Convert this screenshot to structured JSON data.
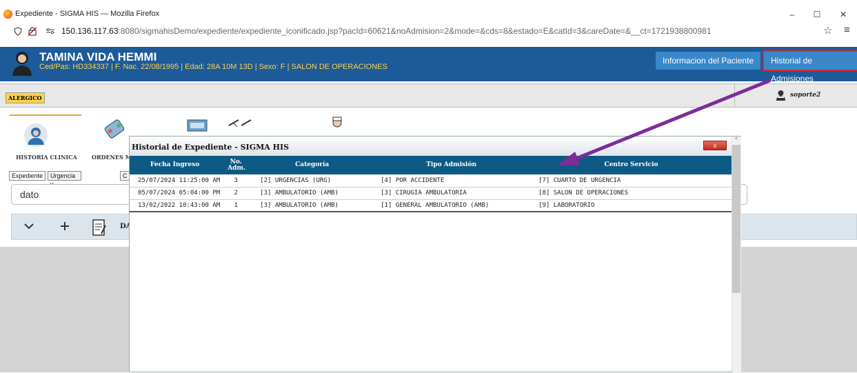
{
  "browser": {
    "tab_title": "Expediente - SIGMA HIS — Mozilla Firefox",
    "url_host": "150.136.117.63",
    "url_rest": ":8080/sigmahisDemo/expediente/expediente_iconificado.jsp?pacId=60621&noAdmision=2&mode=&cds=8&estado=E&catId=3&careDate=&__ct=1721938800981",
    "min": "–",
    "max": "☐",
    "close": "✕"
  },
  "patient": {
    "name": "TAMINA VIDA HEMMI",
    "info": "Ced/Pas: HD334337 | F. Nac. 22/08/1995 | Edad: 28A 10M 13D | Sexo: F  | SALON DE OPERACIONES"
  },
  "header_buttons": {
    "info": "Informacion del Paciente",
    "historial": "Historial de Admisiones"
  },
  "allergy_label": "ALERGICO",
  "user": "soporte2",
  "tools": {
    "historia": "HISTORIA CLINICA",
    "ordenes": "ORDENES M"
  },
  "tabs": [
    "Expediente",
    "Urgencia y Conyugue",
    "C"
  ],
  "search_value": "dato",
  "docbar_label": "DA",
  "modal": {
    "title": "Historial de Expediente - SIGMA HIS",
    "close": "x",
    "columns": [
      "Fecha Ingreso",
      "No. Adm.",
      "Categoría",
      "Tipo Admisión",
      "Centro Servicio"
    ],
    "rows": [
      [
        "25/07/2024 11:25:00 AM",
        "3",
        "[2] URGENCIAS (URG)",
        "[4] POR ACCIDENTE",
        "[7] CUARTO DE URGENCIA"
      ],
      [
        "05/07/2024 05:04:00 PM",
        "2",
        "[3] AMBULATORIO (AMB)",
        "[3] CIRUGIA AMBULATORIA",
        "[8] SALON DE OPERACIONES"
      ],
      [
        "13/02/2022 10:43:00 AM",
        "1",
        "[3] AMBULATORIO (AMB)",
        "[1] GENERAL AMBULATORIO (AMB)",
        "[9] LABORATORIO"
      ]
    ]
  },
  "colors": {
    "header_bg": "#1d5a99",
    "table_header_bg": "#0d5a84",
    "highlight_border": "#d62b2b",
    "annotation_arrow": "#7b2d9c"
  }
}
